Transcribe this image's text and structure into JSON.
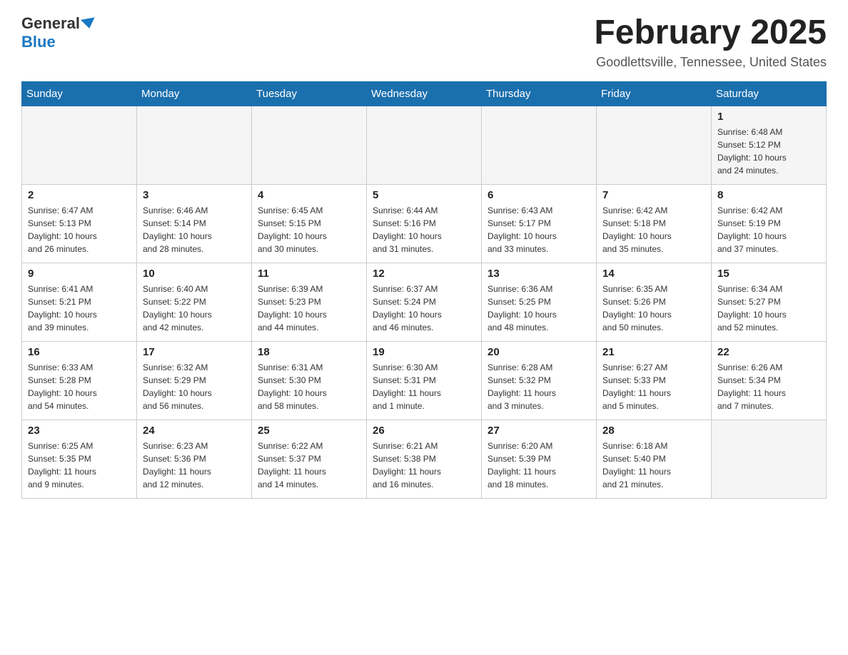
{
  "header": {
    "logo": {
      "general": "General",
      "blue": "Blue",
      "tagline": "GeneralBlue"
    },
    "title": "February 2025",
    "location": "Goodlettsville, Tennessee, United States"
  },
  "weekdays": [
    "Sunday",
    "Monday",
    "Tuesday",
    "Wednesday",
    "Thursday",
    "Friday",
    "Saturday"
  ],
  "weeks": [
    [
      {
        "day": "",
        "info": ""
      },
      {
        "day": "",
        "info": ""
      },
      {
        "day": "",
        "info": ""
      },
      {
        "day": "",
        "info": ""
      },
      {
        "day": "",
        "info": ""
      },
      {
        "day": "",
        "info": ""
      },
      {
        "day": "1",
        "info": "Sunrise: 6:48 AM\nSunset: 5:12 PM\nDaylight: 10 hours\nand 24 minutes."
      }
    ],
    [
      {
        "day": "2",
        "info": "Sunrise: 6:47 AM\nSunset: 5:13 PM\nDaylight: 10 hours\nand 26 minutes."
      },
      {
        "day": "3",
        "info": "Sunrise: 6:46 AM\nSunset: 5:14 PM\nDaylight: 10 hours\nand 28 minutes."
      },
      {
        "day": "4",
        "info": "Sunrise: 6:45 AM\nSunset: 5:15 PM\nDaylight: 10 hours\nand 30 minutes."
      },
      {
        "day": "5",
        "info": "Sunrise: 6:44 AM\nSunset: 5:16 PM\nDaylight: 10 hours\nand 31 minutes."
      },
      {
        "day": "6",
        "info": "Sunrise: 6:43 AM\nSunset: 5:17 PM\nDaylight: 10 hours\nand 33 minutes."
      },
      {
        "day": "7",
        "info": "Sunrise: 6:42 AM\nSunset: 5:18 PM\nDaylight: 10 hours\nand 35 minutes."
      },
      {
        "day": "8",
        "info": "Sunrise: 6:42 AM\nSunset: 5:19 PM\nDaylight: 10 hours\nand 37 minutes."
      }
    ],
    [
      {
        "day": "9",
        "info": "Sunrise: 6:41 AM\nSunset: 5:21 PM\nDaylight: 10 hours\nand 39 minutes."
      },
      {
        "day": "10",
        "info": "Sunrise: 6:40 AM\nSunset: 5:22 PM\nDaylight: 10 hours\nand 42 minutes."
      },
      {
        "day": "11",
        "info": "Sunrise: 6:39 AM\nSunset: 5:23 PM\nDaylight: 10 hours\nand 44 minutes."
      },
      {
        "day": "12",
        "info": "Sunrise: 6:37 AM\nSunset: 5:24 PM\nDaylight: 10 hours\nand 46 minutes."
      },
      {
        "day": "13",
        "info": "Sunrise: 6:36 AM\nSunset: 5:25 PM\nDaylight: 10 hours\nand 48 minutes."
      },
      {
        "day": "14",
        "info": "Sunrise: 6:35 AM\nSunset: 5:26 PM\nDaylight: 10 hours\nand 50 minutes."
      },
      {
        "day": "15",
        "info": "Sunrise: 6:34 AM\nSunset: 5:27 PM\nDaylight: 10 hours\nand 52 minutes."
      }
    ],
    [
      {
        "day": "16",
        "info": "Sunrise: 6:33 AM\nSunset: 5:28 PM\nDaylight: 10 hours\nand 54 minutes."
      },
      {
        "day": "17",
        "info": "Sunrise: 6:32 AM\nSunset: 5:29 PM\nDaylight: 10 hours\nand 56 minutes."
      },
      {
        "day": "18",
        "info": "Sunrise: 6:31 AM\nSunset: 5:30 PM\nDaylight: 10 hours\nand 58 minutes."
      },
      {
        "day": "19",
        "info": "Sunrise: 6:30 AM\nSunset: 5:31 PM\nDaylight: 11 hours\nand 1 minute."
      },
      {
        "day": "20",
        "info": "Sunrise: 6:28 AM\nSunset: 5:32 PM\nDaylight: 11 hours\nand 3 minutes."
      },
      {
        "day": "21",
        "info": "Sunrise: 6:27 AM\nSunset: 5:33 PM\nDaylight: 11 hours\nand 5 minutes."
      },
      {
        "day": "22",
        "info": "Sunrise: 6:26 AM\nSunset: 5:34 PM\nDaylight: 11 hours\nand 7 minutes."
      }
    ],
    [
      {
        "day": "23",
        "info": "Sunrise: 6:25 AM\nSunset: 5:35 PM\nDaylight: 11 hours\nand 9 minutes."
      },
      {
        "day": "24",
        "info": "Sunrise: 6:23 AM\nSunset: 5:36 PM\nDaylight: 11 hours\nand 12 minutes."
      },
      {
        "day": "25",
        "info": "Sunrise: 6:22 AM\nSunset: 5:37 PM\nDaylight: 11 hours\nand 14 minutes."
      },
      {
        "day": "26",
        "info": "Sunrise: 6:21 AM\nSunset: 5:38 PM\nDaylight: 11 hours\nand 16 minutes."
      },
      {
        "day": "27",
        "info": "Sunrise: 6:20 AM\nSunset: 5:39 PM\nDaylight: 11 hours\nand 18 minutes."
      },
      {
        "day": "28",
        "info": "Sunrise: 6:18 AM\nSunset: 5:40 PM\nDaylight: 11 hours\nand 21 minutes."
      },
      {
        "day": "",
        "info": ""
      }
    ]
  ]
}
